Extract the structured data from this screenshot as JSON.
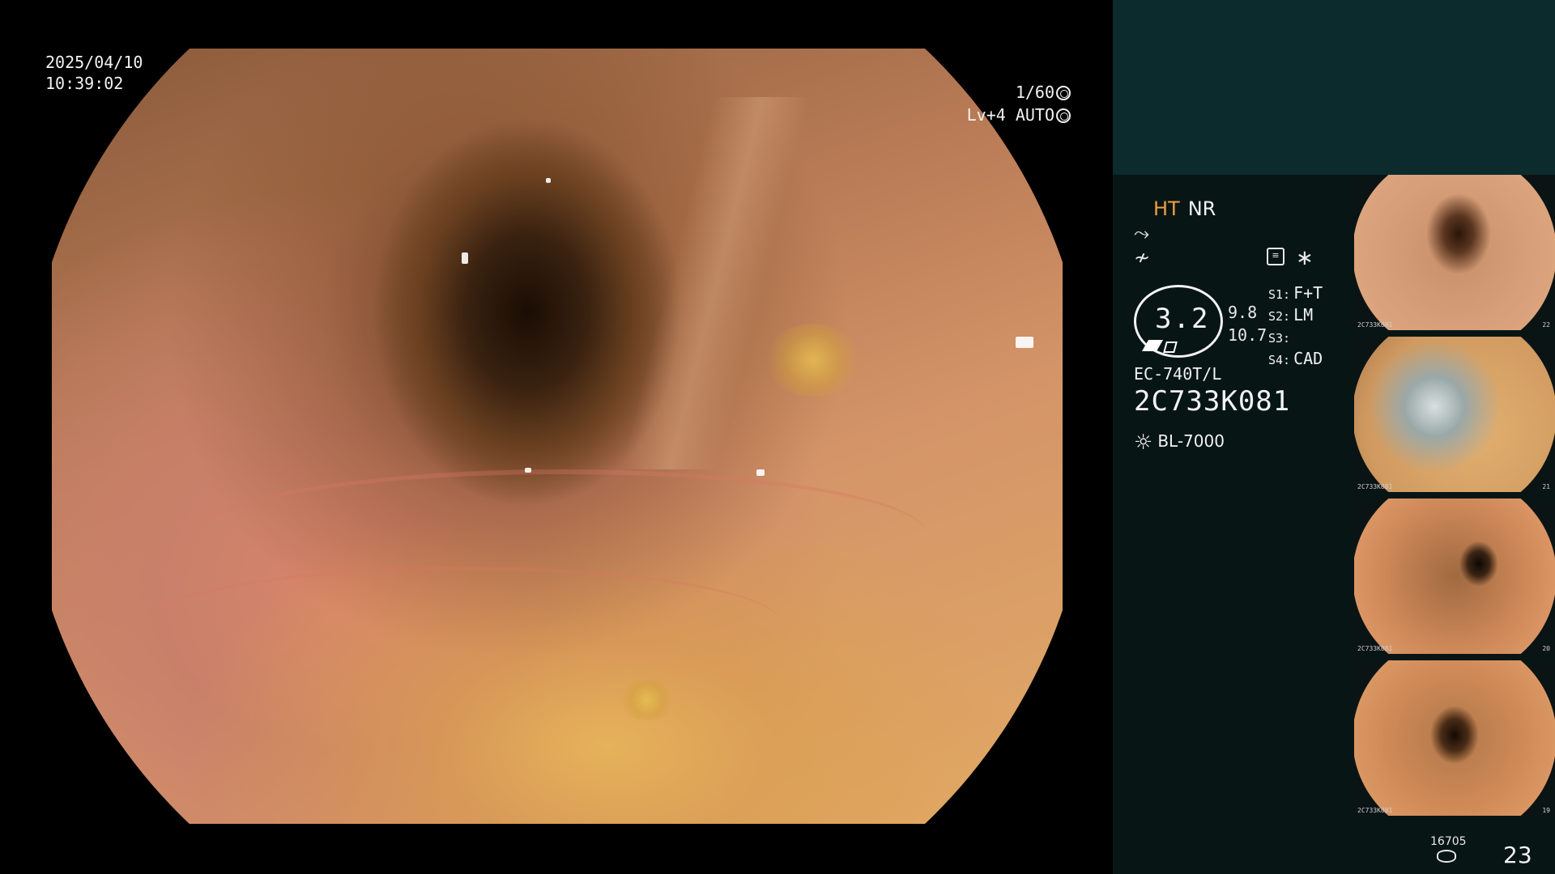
{
  "overlay": {
    "date": "2025/04/10",
    "time": "10:39:02",
    "shutter": "1/60",
    "level": "Lv+4",
    "exposure_mode": "AUTO"
  },
  "panel": {
    "ht_label": "HT",
    "nr_label": "NR",
    "zoom_value": "3.2",
    "zoom_sub_1": "9.8",
    "zoom_sub_2": "10.7",
    "switches": [
      {
        "key": "S1:",
        "value": "F+T"
      },
      {
        "key": "S2:",
        "value": "LM"
      },
      {
        "key": "S3:",
        "value": ""
      },
      {
        "key": "S4:",
        "value": "CAD"
      }
    ],
    "scope_model": "EC-740T/L",
    "scope_serial": "2C733K081",
    "light_source": "BL-7000",
    "storage_count": "16705",
    "image_count": "23"
  },
  "thumbnails": [
    {
      "caption": "2C733K081",
      "number": "22"
    },
    {
      "caption": "2C733K081",
      "number": "21"
    },
    {
      "caption": "2C733K081",
      "number": "20"
    },
    {
      "caption": "2C733K081",
      "number": "19"
    }
  ],
  "icons": {
    "shutter_icon": "aperture-icon",
    "auto_icon": "auto-exposure-icon",
    "menu_icon": "settings-menu-icon",
    "star_icon": "asterisk-icon",
    "light_icon": "sun-icon",
    "storage_icon": "database-icon"
  },
  "colors": {
    "ht_accent": "#f0a040",
    "panel_top": "#0c2b2d",
    "panel_bg": "#081515"
  }
}
